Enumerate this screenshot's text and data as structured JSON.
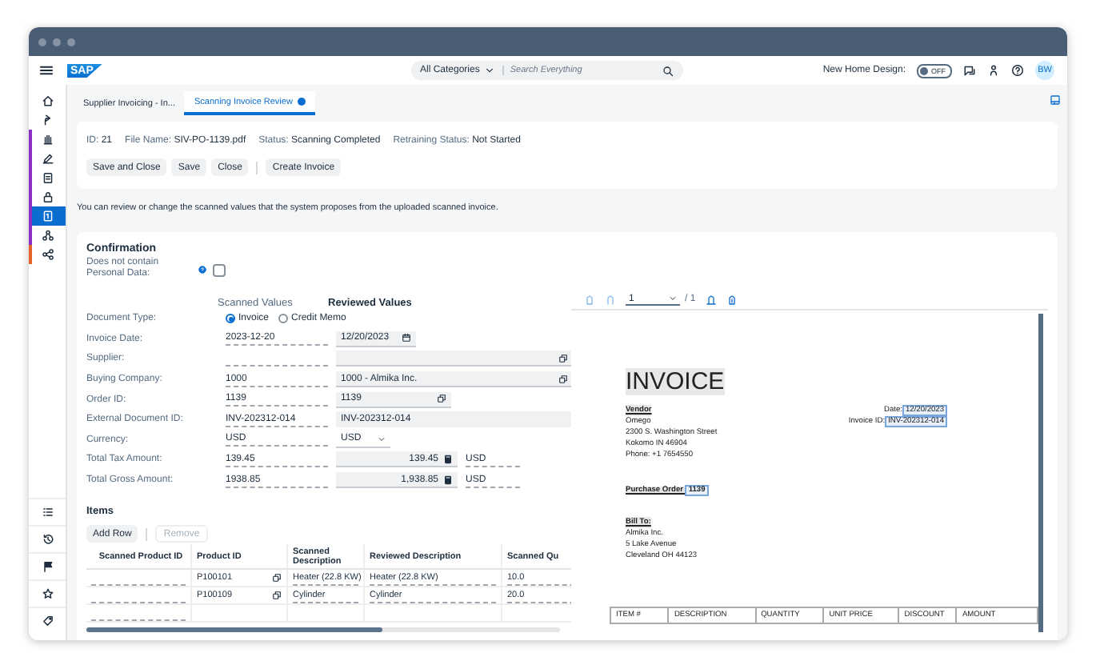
{
  "shell": {
    "logo": "SAP",
    "search": {
      "category": "All Categories",
      "placeholder": "Search Everything"
    },
    "new_home_design": {
      "label": "New Home Design:",
      "toggle_text": "OFF",
      "on": false
    },
    "avatar": "BW"
  },
  "sidebar": {
    "items": [
      {
        "selected": false
      },
      {
        "selected": false
      },
      {
        "selected": false,
        "color": "#8b2fc9"
      },
      {
        "selected": false,
        "color": "#8b2fc9"
      },
      {
        "selected": false,
        "color": "#8b2fc9"
      },
      {
        "selected": false,
        "color": "#8b2fc9"
      },
      {
        "selected": true,
        "color": "#8b2fc9"
      },
      {
        "selected": false,
        "color": "#8b2fc9"
      },
      {
        "selected": false,
        "color": "#e8632b"
      }
    ],
    "bottom_items": [
      {
        "selected": false
      },
      {
        "selected": false
      },
      {
        "selected": false
      },
      {
        "selected": false
      },
      {
        "selected": false
      }
    ]
  },
  "tabs": [
    {
      "label": "Supplier Invoicing - In...",
      "selected": false
    },
    {
      "label": "Scanning Invoice Review",
      "selected": true
    }
  ],
  "object_header": {
    "attributes": [
      {
        "label": "ID:",
        "value": "21"
      },
      {
        "label": "File Name:",
        "value": "SIV-PO-1139.pdf"
      },
      {
        "label": "Status:",
        "value": "Scanning Completed"
      },
      {
        "label": "Retraining Status:",
        "value": "Not Started"
      }
    ],
    "action_groups": [
      [
        "Save and Close",
        "Save",
        "Close"
      ],
      [
        "Create Invoice"
      ]
    ]
  },
  "info_text": "You can review or change the scanned values that the system proposes from the uploaded scanned invoice.",
  "confirmation": {
    "title": "Confirmation",
    "personal_data": {
      "label": "Does not contain Personal Data:",
      "checked": false
    }
  },
  "form": {
    "columns": [
      "Scanned Values",
      "Reviewed Values"
    ],
    "rows": [
      {
        "kind": "radio",
        "label": "Document Type:",
        "options": [
          {
            "label": "Invoice",
            "selected": true
          },
          {
            "label": "Credit Memo",
            "selected": false
          }
        ]
      },
      {
        "kind": "date",
        "label": "Invoice Date:",
        "scanned": "2023-12-20",
        "reviewed": "12/20/2023"
      },
      {
        "kind": "lookup",
        "label": "Supplier:"
      },
      {
        "kind": "lookup",
        "label": "Buying Company:",
        "scanned": "1000",
        "reviewed": "1000 - Almika Inc."
      },
      {
        "kind": "lookup_short",
        "label": "Order ID:",
        "scanned": "1139",
        "reviewed": "1139"
      },
      {
        "kind": "text",
        "label": "External Document ID:",
        "scanned": "INV-202312-014",
        "reviewed": "INV-202312-014"
      },
      {
        "kind": "select",
        "label": "Currency:",
        "scanned": "USD",
        "reviewed": "USD"
      },
      {
        "kind": "amount",
        "label": "Total Tax Amount:",
        "scanned": "139.45",
        "reviewed": "139.45",
        "unit": "USD"
      },
      {
        "kind": "amount",
        "label": "Total Gross Amount:",
        "scanned": "1938.85",
        "reviewed": "1,938.85",
        "unit": "USD"
      }
    ]
  },
  "items": {
    "title": "Items",
    "actions": [
      {
        "label": "Add Row",
        "disabled": false
      },
      {
        "label": "Remove",
        "disabled": true
      }
    ],
    "columns": [
      "Scanned Product ID",
      "Product ID",
      "Scanned Description",
      "Reviewed Description",
      "Scanned Qu"
    ],
    "rows": [
      {
        "product_id": "P100101",
        "scanned_description": "Heater (22.8 KW)",
        "reviewed_description": "Heater (22.8 KW)",
        "scanned_quantity": "10.0"
      },
      {
        "product_id": "P100109",
        "scanned_description": "Cylinder",
        "reviewed_description": "Cylinder",
        "scanned_quantity": "20.0"
      },
      {}
    ]
  },
  "viewer": {
    "page": "1",
    "page_count": "/ 1",
    "document": {
      "title": "INVOICE",
      "vendor": {
        "heading": "Vendor",
        "lines": [
          "Omego",
          "2300 S. Washington Street",
          "Kokomo IN 46904",
          "Phone: +1 7654550"
        ]
      },
      "date_label": "Date:",
      "date": "12/20/2023",
      "invoice_id_label": "Invoice ID:",
      "invoice_id": "INV-202312-014",
      "po_label": "Purchase Order",
      "po": "1139",
      "bill_to": {
        "heading": "Bill To:",
        "lines": [
          "Almika Inc.",
          "5 Lake Avenue",
          "Cleveland OH  44123"
        ]
      },
      "table_columns": [
        "ITEM #",
        "DESCRIPTION",
        "QUANTITY",
        "UNIT PRICE",
        "DISCOUNT",
        "AMOUNT"
      ]
    }
  }
}
